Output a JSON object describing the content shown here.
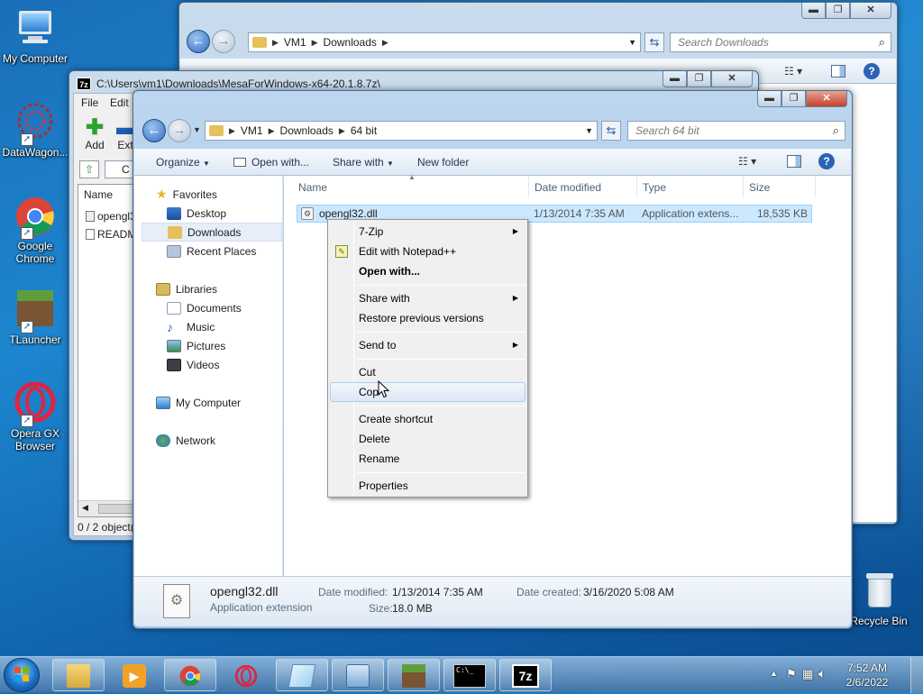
{
  "desktop": {
    "icons": [
      {
        "label": "My Computer"
      },
      {
        "label": "DataWagon..."
      },
      {
        "label": "Google Chrome"
      },
      {
        "label": "TLauncher"
      },
      {
        "label": "Opera GX Browser"
      },
      {
        "label": "Recycle Bin"
      }
    ]
  },
  "back_window": {
    "path": [
      "VM1",
      "Downloads"
    ],
    "search_placeholder": "Search Downloads"
  },
  "sevenzip_window": {
    "title": "C:\\Users\\vm1\\Downloads\\MesaForWindows-x64-20.1.8.7z\\",
    "menu": [
      "File",
      "Edit"
    ],
    "toolbar": {
      "add": "Add",
      "extract": "Extr"
    },
    "path_fragment": "C",
    "col_name": "Name",
    "files": [
      "opengl3",
      "READM"
    ],
    "status": "0 / 2 object("
  },
  "explorer": {
    "path": [
      "VM1",
      "Downloads",
      "64 bit"
    ],
    "search_placeholder": "Search 64 bit",
    "toolbar": {
      "organize": "Organize",
      "open_with": "Open with...",
      "share_with": "Share with",
      "new_folder": "New folder"
    },
    "nav": {
      "favorites": "Favorites",
      "desktop": "Desktop",
      "downloads": "Downloads",
      "recent": "Recent Places",
      "libraries": "Libraries",
      "documents": "Documents",
      "music": "Music",
      "pictures": "Pictures",
      "videos": "Videos",
      "computer": "My Computer",
      "network": "Network"
    },
    "columns": {
      "name": "Name",
      "date": "Date modified",
      "type": "Type",
      "size": "Size"
    },
    "file": {
      "name": "opengl32.dll",
      "date": "1/13/2014 7:35 AM",
      "type": "Application extens...",
      "size": "18,535 KB"
    },
    "details": {
      "name": "opengl32.dll",
      "kind": "Application extension",
      "date_modified_label": "Date modified:",
      "date_modified": "1/13/2014 7:35 AM",
      "size_label": "Size:",
      "size": "18.0 MB",
      "date_created_label": "Date created:",
      "date_created": "3/16/2020 5:08 AM"
    }
  },
  "context_menu": {
    "items": [
      "7-Zip",
      "Edit with Notepad++",
      "Open with...",
      "Share with",
      "Restore previous versions",
      "Send to",
      "Cut",
      "Cop",
      "Create shortcut",
      "Delete",
      "Rename",
      "Properties"
    ]
  },
  "taskbar": {
    "time": "7:52 AM",
    "date": "2/6/2022",
    "cmd_label": "C:\\_",
    "zip_label": "7z"
  },
  "colors": {
    "accent": "#2e6cc0",
    "selection": "#cce8ff",
    "menu_highlight": "#dde8f6"
  }
}
